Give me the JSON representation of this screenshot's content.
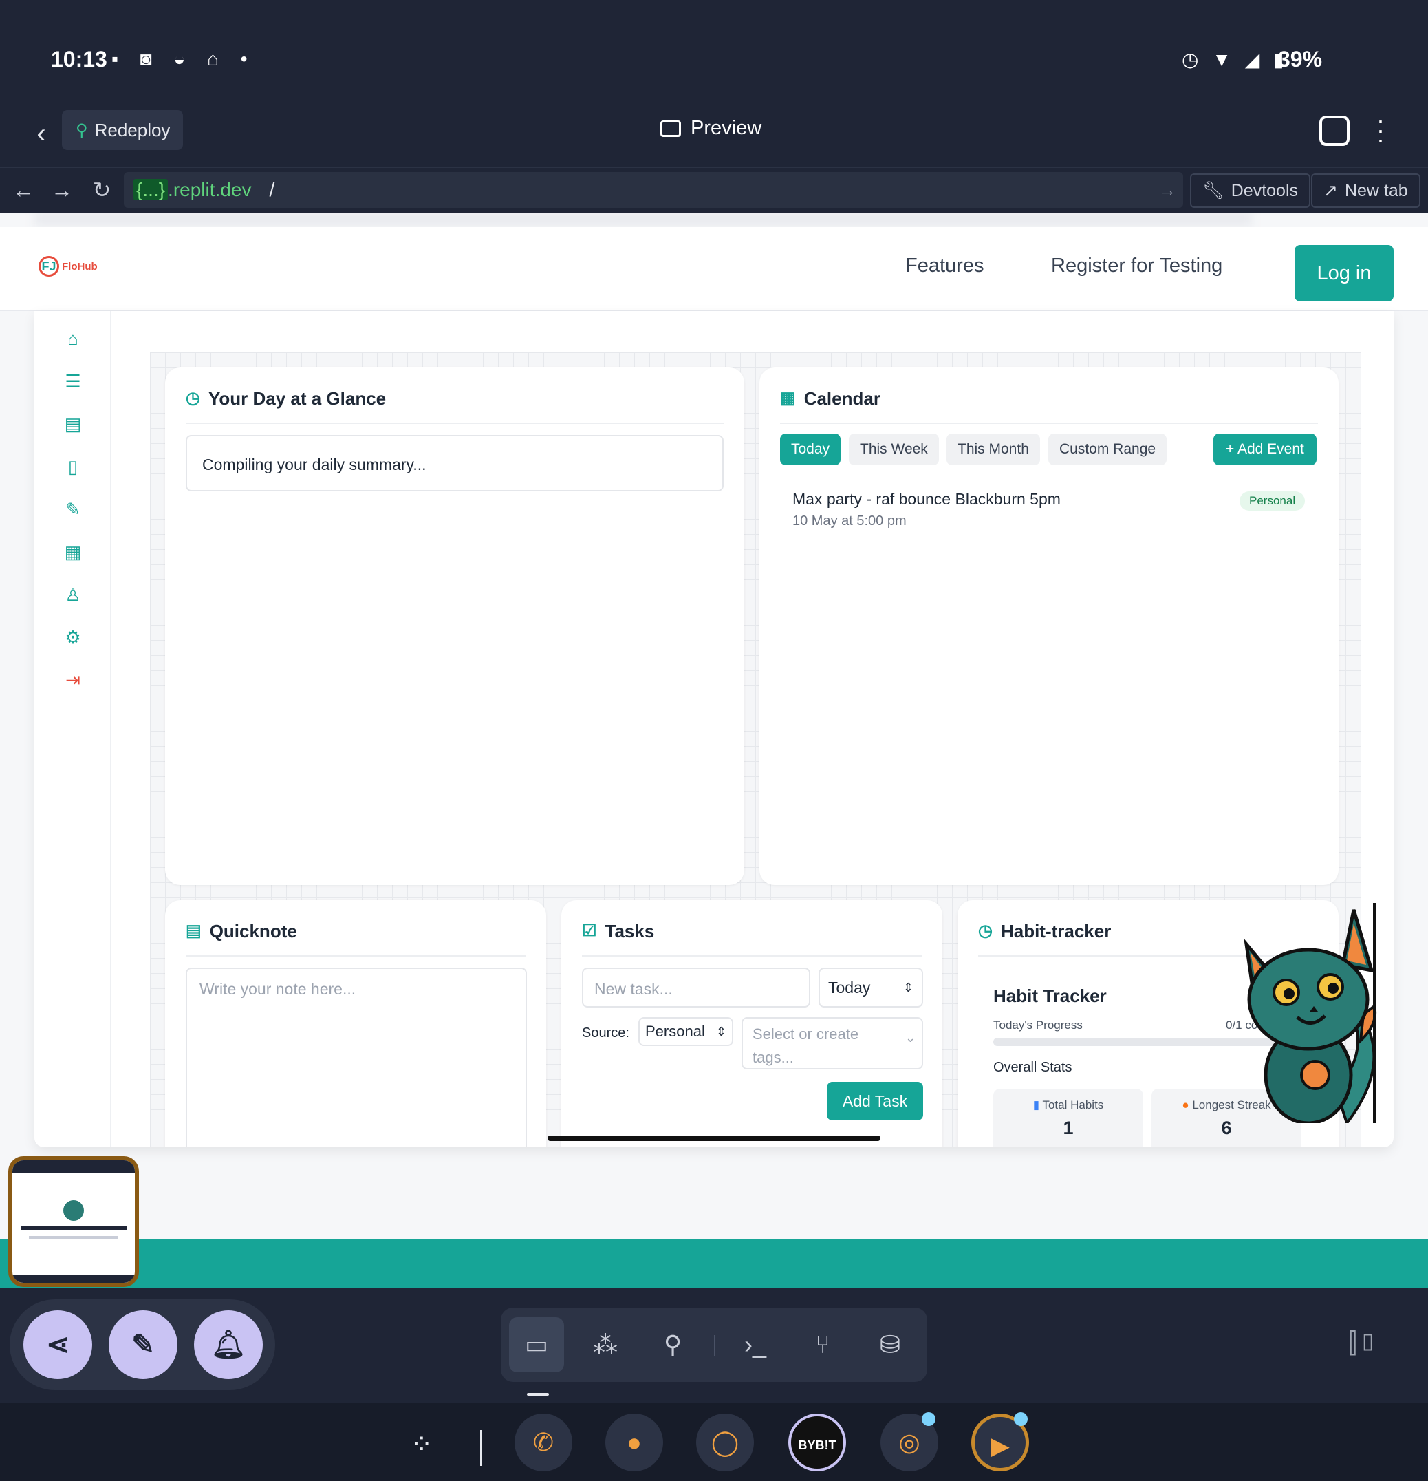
{
  "status_bar": {
    "time": "10:13",
    "left_icons": "▪ ◙ ◒ ⌂ •",
    "right_icons": "◷ ▼ ◢ ▮",
    "battery": "39%"
  },
  "app_header": {
    "redeploy_label": "Redeploy",
    "title": "Preview"
  },
  "url_bar": {
    "host_brace": "{...}",
    "host": ".replit.dev",
    "path": "/",
    "devtools_label": "Devtools",
    "new_tab_label": "New tab"
  },
  "site": {
    "logo_mark": "FJ",
    "logo_name": "FloHub",
    "nav": {
      "features": "Features",
      "register": "Register for Testing",
      "login": "Log in"
    }
  },
  "glance": {
    "title": "Your Day at a Glance",
    "summary": "Compiling your daily summary..."
  },
  "calendar": {
    "title": "Calendar",
    "filters": [
      "Today",
      "This Week",
      "This Month",
      "Custom Range"
    ],
    "active_filter": "Today",
    "add_event_label": "+  Add Event",
    "event": {
      "title": "Max party - raf bounce Blackburn 5pm",
      "time": "10 May at 5:00 pm",
      "badge": "Personal"
    }
  },
  "quicknote": {
    "title": "Quicknote",
    "placeholder": "Write your note here..."
  },
  "tasks": {
    "title": "Tasks",
    "new_task_placeholder": "New task...",
    "due_value": "Today",
    "source_label": "Source:",
    "source_value": "Personal",
    "tags_placeholder": "Select or create tags...",
    "add_task_label": "Add Task"
  },
  "habit_tracker": {
    "title": "Habit-tracker",
    "inner_title": "Habit Tracker",
    "progress_label": "Today's Progress",
    "progress_value": "0/1 co",
    "progress_fraction": 0,
    "overall_label": "Overall Stats",
    "total_habits_label": "Total Habits",
    "total_habits_value": "1",
    "longest_streak_label": "Longest Streak",
    "longest_streak_value": "6"
  },
  "dock": {
    "bybit_label": "BYB!T"
  },
  "colors": {
    "accent": "#16a597",
    "dark": "#1f2536",
    "danger": "#e74c3c",
    "fab": "#c9c3f3"
  }
}
